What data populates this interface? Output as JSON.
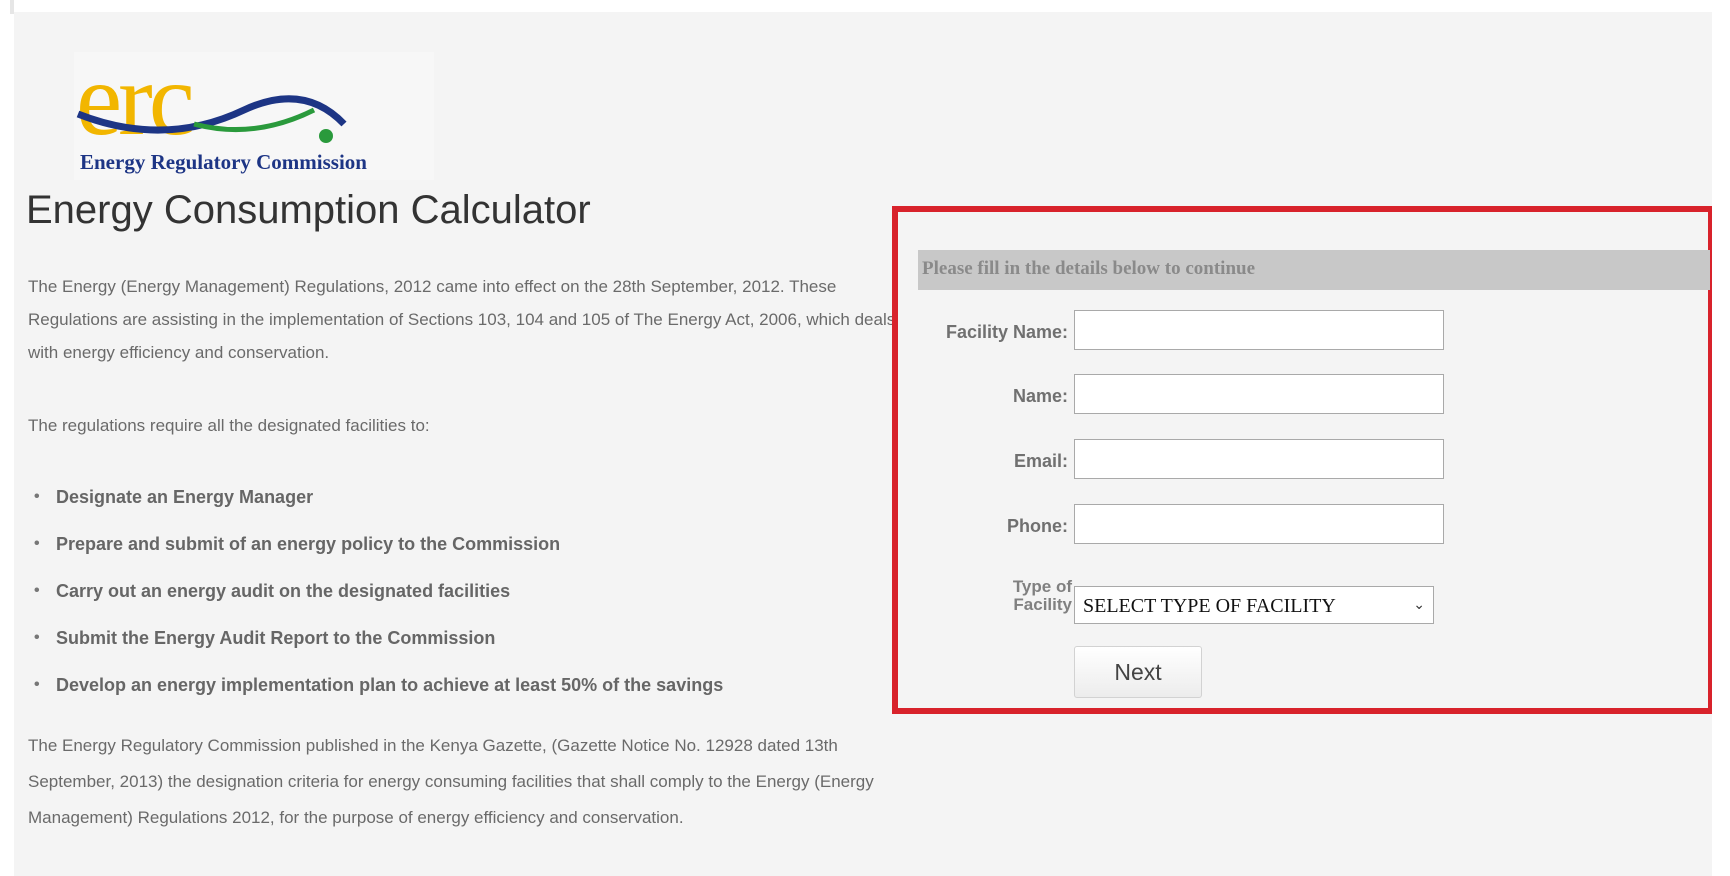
{
  "logo": {
    "wordmark": "erc.",
    "caption": "Energy Regulatory Commission",
    "colors": {
      "wordmark": "#f2b600",
      "swoosh_blue": "#1d3585",
      "swoosh_green": "#2a9a3c"
    }
  },
  "page_title": "Energy Consumption Calculator",
  "intro": "The Energy (Energy Management) Regulations, 2012 came into effect on the 28th September, 2012. These Regulations are assisting in the implementation of Sections 103, 104 and 105 of The Energy Act, 2006, which deals with energy efficiency and conservation.",
  "lead": "The regulations require all the designated facilities to:",
  "requirements": [
    "Designate an Energy Manager",
    "Prepare and submit of an energy policy to the Commission",
    "Carry out an energy audit on the designated facilities",
    "Submit the Energy Audit Report to the Commission",
    "Develop an energy implementation plan to achieve at least 50% of the savings"
  ],
  "closing": "The Energy Regulatory Commission published in the Kenya Gazette, (Gazette Notice No. 12928 dated 13th September, 2013) the designation criteria for energy consuming facilities that shall comply to the Energy (Energy Management) Regulations 2012, for the purpose of energy efficiency and conservation.",
  "form": {
    "header": "Please fill in the details below to continue",
    "facility_name_label": "Facility Name:",
    "facility_name_value": "",
    "name_label": "Name:",
    "name_value": "",
    "email_label": "Email:",
    "email_value": "",
    "phone_label": "Phone:",
    "phone_value": "",
    "type_label_line1": "Type of",
    "type_label_line2": "Facility",
    "type_selected": "SELECT TYPE OF FACILITY",
    "next_label": "Next",
    "highlight_color": "#d8222b"
  }
}
